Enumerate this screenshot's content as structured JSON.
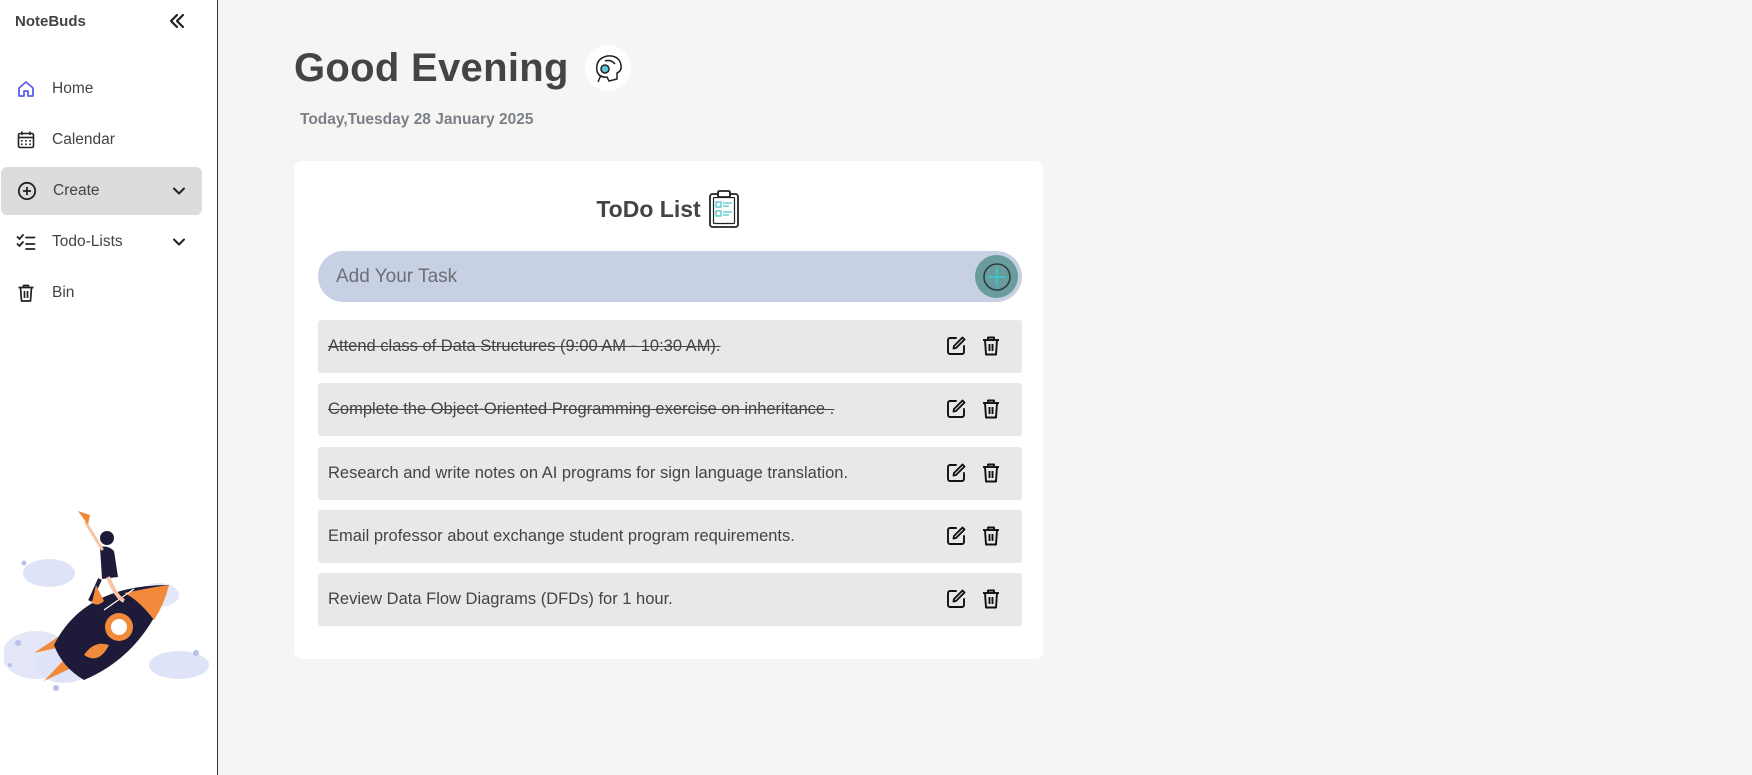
{
  "app": {
    "brand": "NoteBuds"
  },
  "sidebar": {
    "items": [
      {
        "label": "Home",
        "icon": "home-icon"
      },
      {
        "label": "Calendar",
        "icon": "calendar-icon"
      },
      {
        "label": "Create",
        "icon": "plus-circle-icon",
        "expandable": true,
        "active": true
      },
      {
        "label": "Todo-Lists",
        "icon": "checklist-icon",
        "expandable": true
      },
      {
        "label": "Bin",
        "icon": "trash-icon"
      }
    ]
  },
  "main": {
    "greeting": "Good Evening",
    "date": "Today,Tuesday 28 January 2025"
  },
  "todo": {
    "title": "ToDo List",
    "input_placeholder": "Add Your Task",
    "tasks": [
      {
        "text": "Attend class of Data Structures (9:00 AM - 10:30 AM).",
        "done": true
      },
      {
        "text": "Complete the Object-Oriented Programming exercise on inheritance .",
        "done": true
      },
      {
        "text": "Research and write notes on AI programs for sign language translation.",
        "done": false
      },
      {
        "text": "Email professor about exchange student program requirements.",
        "done": false
      },
      {
        "text": "Review Data Flow Diagrams (DFDs) for 1 hour.",
        "done": false
      }
    ]
  },
  "colors": {
    "accent": "#5b5fef",
    "add_bar": "#c8d1e4",
    "add_button": "#6a9c9e",
    "task_bg": "#e8e8ea",
    "active_nav": "#dcdcdc"
  }
}
